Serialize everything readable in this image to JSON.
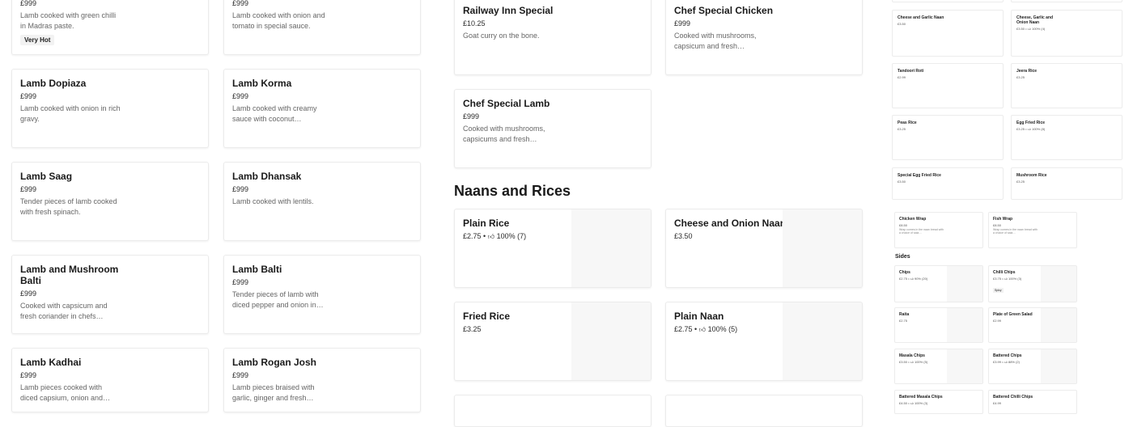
{
  "left_cards": [
    {
      "title": "",
      "price": "£999",
      "desc": "Lamb cooked with green chilli in Madras paste.",
      "badge": "Very Hot"
    },
    {
      "title": "",
      "price": "£999",
      "desc": "Lamb cooked with onion and tomato in special sauce.",
      "badge": ""
    },
    {
      "title": "Lamb Dopiaza",
      "price": "£999",
      "desc": "Lamb cooked with onion in rich gravy.",
      "badge": ""
    },
    {
      "title": "Lamb Korma",
      "price": "£999",
      "desc": "Lamb cooked with creamy sauce with coconut…",
      "badge": ""
    },
    {
      "title": "Lamb Saag",
      "price": "£999",
      "desc": "Tender pieces of lamb cooked with fresh spinach.",
      "badge": ""
    },
    {
      "title": "Lamb Dhansak",
      "price": "£999",
      "desc": "Lamb cooked with lentils.",
      "badge": ""
    },
    {
      "title": "Lamb and Mushroom Balti",
      "price": "£999",
      "desc": "Cooked with capsicum and fresh coriander in chefs…",
      "badge": ""
    },
    {
      "title": "Lamb Balti",
      "price": "£999",
      "desc": "Tender pieces of lamb with diced pepper and onion in…",
      "badge": ""
    },
    {
      "title": "Lamb Kadhai",
      "price": "£999",
      "desc": "Lamb pieces cooked with diced capsium, onion and…",
      "badge": ""
    },
    {
      "title": "Lamb Rogan Josh",
      "price": "£999",
      "desc": "Lamb pieces braised with garlic, ginger and fresh…",
      "badge": ""
    }
  ],
  "middle": {
    "specials": [
      {
        "title": "Railway Inn Special",
        "price": "£10.25",
        "desc": "Goat curry on the bone."
      },
      {
        "title": "Chef Special Chicken",
        "price": "£999",
        "desc": "Cooked with mushrooms, capsicum and fresh…"
      },
      {
        "title": "Chef Special Lamb",
        "price": "£999",
        "desc": "Cooked with mushrooms, capsicums and fresh…"
      }
    ],
    "section_title": "Naans and Rices",
    "naans": [
      {
        "title": "Plain Rice",
        "price": "£2.75 •",
        "rating": "100% (7)"
      },
      {
        "title": "Cheese and Onion Naan",
        "price": "£3.50",
        "rating": ""
      },
      {
        "title": "Fried Rice",
        "price": "£3.25",
        "rating": ""
      },
      {
        "title": "Plain Naan",
        "price": "£2.75 •",
        "rating": "100% (5)"
      }
    ]
  },
  "right_top": [
    {
      "title": "Cheese and Garlic Naan",
      "price": "£3.50",
      "rating": ""
    },
    {
      "title": "Cheese, Garlic and Onion Naan",
      "price": "£3.50 •",
      "rating": "100% (4)"
    },
    {
      "title": "Tandoori Roti",
      "price": "£2.99",
      "rating": ""
    },
    {
      "title": "Jeera Rice",
      "price": "£3.25",
      "rating": ""
    },
    {
      "title": "Peas Rice",
      "price": "£3.25",
      "rating": ""
    },
    {
      "title": "Egg Fried Rice",
      "price": "£3.25 •",
      "rating": "100% (8)"
    },
    {
      "title": "Special Egg Fried Rice",
      "price": "£3.50",
      "rating": ""
    },
    {
      "title": "Mushroom Rice",
      "price": "£3.25",
      "rating": ""
    }
  ],
  "right_wraps": [
    {
      "title": "Chicken Wrap",
      "price": "£8.50",
      "desc": "Wrap comes in the naan bread with a choice of sala…"
    },
    {
      "title": "Fish Wrap",
      "price": "£8.50",
      "desc": "Wrap comes in the naan bread with a choice of sala…"
    }
  ],
  "sides_title": "Sides",
  "right_sides": [
    {
      "title": "Chips",
      "price": "£2.75 •",
      "rating": "90% (20)",
      "badge": ""
    },
    {
      "title": "Chilli Chips",
      "price": "£3.75 •",
      "rating": "100% (3)",
      "badge": "Spicy"
    },
    {
      "title": "Raita",
      "price": "£2.75",
      "rating": "",
      "badge": ""
    },
    {
      "title": "Plate of Green Salad",
      "price": "£2.99",
      "rating": "",
      "badge": ""
    },
    {
      "title": "Masala Chips",
      "price": "£3.50 •",
      "rating": "100% (5)",
      "badge": ""
    },
    {
      "title": "Battered Chips",
      "price": "£3.99 •",
      "rating": "88% (2)",
      "badge": ""
    },
    {
      "title": "Battered Masala Chips",
      "price": "£4.50 •",
      "rating": "100% (3)",
      "badge": ""
    },
    {
      "title": "Battered Chilli Chips",
      "price": "£4.99",
      "rating": "",
      "badge": ""
    }
  ],
  "icons": {
    "thumbs_up": "thumbs-up-icon"
  }
}
